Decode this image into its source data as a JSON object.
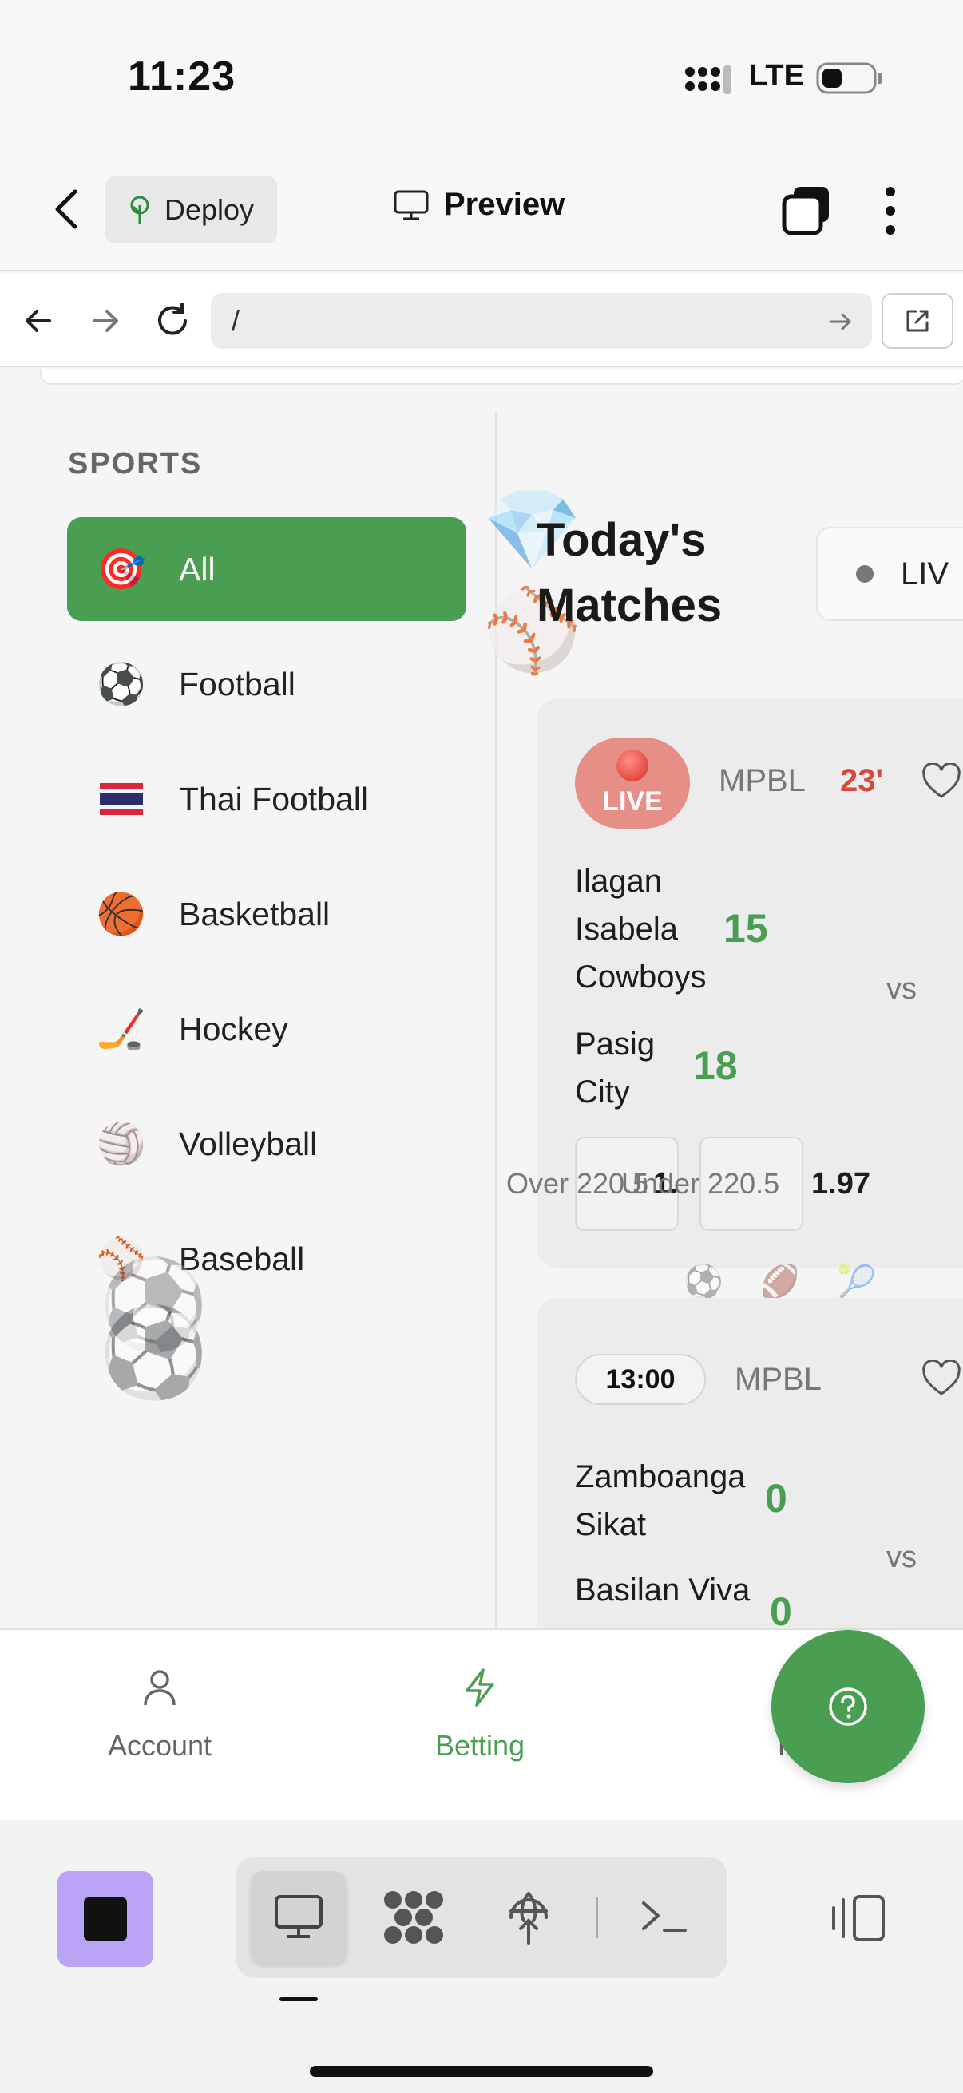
{
  "status_bar": {
    "time": "11:23",
    "network": "LTE"
  },
  "app_header": {
    "deploy_label": "Deploy",
    "preview_label": "Preview"
  },
  "url_bar": {
    "path": "/"
  },
  "sidebar": {
    "heading": "SPORTS",
    "items": [
      {
        "label": "All",
        "icon": "🎯",
        "active": true
      },
      {
        "label": "Football",
        "icon": "⚽"
      },
      {
        "label": "Thai Football",
        "icon": "🇹🇭"
      },
      {
        "label": "Basketball",
        "icon": "🏀"
      },
      {
        "label": "Hockey",
        "icon": "🏒"
      },
      {
        "label": "Volleyball",
        "icon": "🏐"
      },
      {
        "label": "Baseball",
        "icon": "⚾"
      }
    ]
  },
  "main": {
    "title_line1": "Today's",
    "title_line2": "Matches",
    "live_filter": "LIV",
    "matches": [
      {
        "status": "LIVE",
        "league": "MPBL",
        "minute": "23'",
        "home_line1": "Ilagan",
        "home_line2": "Isabela",
        "home_line3": "Cowboys",
        "home_score": "15",
        "away_line1": "Pasig",
        "away_line2": "City",
        "away_score": "18",
        "vs": "vs",
        "odds": {
          "over_label": "Over 220.5",
          "over_value": "1.",
          "under_label": "Under 220.5",
          "under_value": "1.97"
        }
      },
      {
        "time": "13:00",
        "league": "MPBL",
        "home_line1": "Zamboanga",
        "home_line2": "Sikat",
        "home_score": "0",
        "away_line1": "Basilan Viva",
        "away_score": "0",
        "vs": "vs"
      }
    ]
  },
  "bottom_nav": {
    "items": [
      {
        "label": "Account",
        "icon": "user-icon"
      },
      {
        "label": "Betting",
        "icon": "bolt-icon",
        "active": true
      },
      {
        "label": "His",
        "icon": "history-icon"
      }
    ]
  },
  "colors": {
    "accent_green": "#4a9e52",
    "live_red": "#d9463b",
    "stop_purple": "#b9a4f5"
  }
}
